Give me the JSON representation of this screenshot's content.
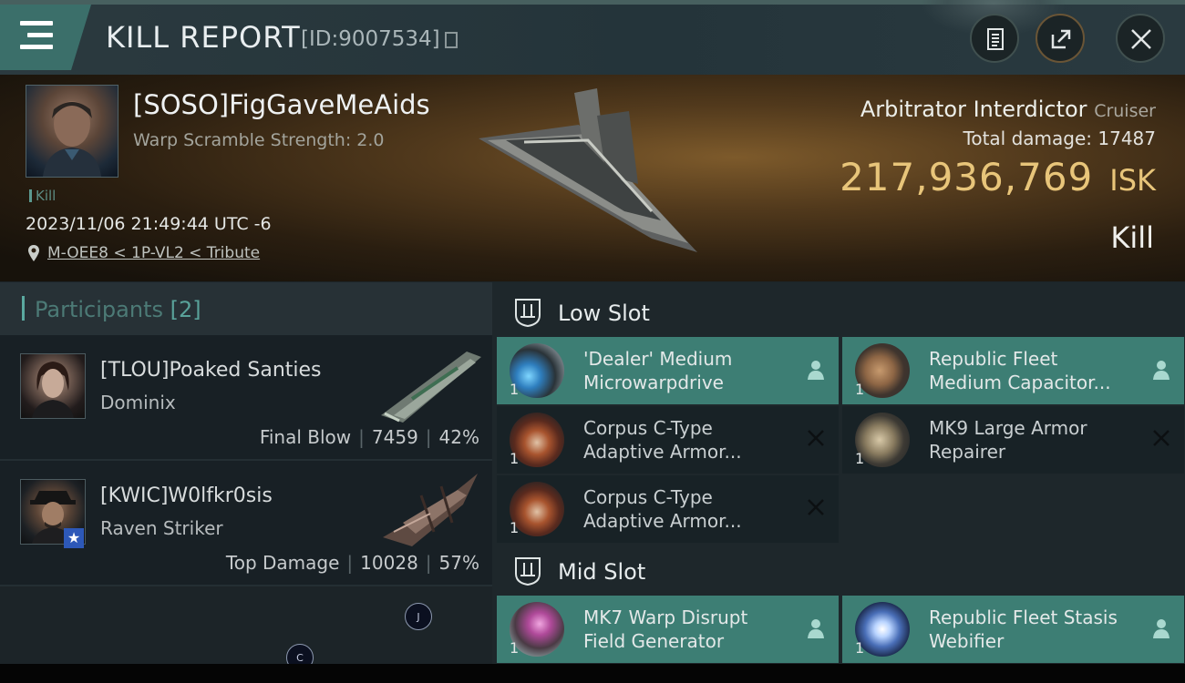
{
  "header": {
    "title": "KILL REPORT",
    "report_id": "[ID:9007534]"
  },
  "summary": {
    "pilot_name": "[SOSO]FigGaveMeAids",
    "warp_scramble": "Warp Scramble Strength: 2.0",
    "kill_tag": "Kill",
    "datetime": "2023/11/06 21:49:44 UTC -6",
    "location": "M-OEE8 < 1P-VL2 < Tribute",
    "ship_name": "Arbitrator Interdictor",
    "ship_class": "Cruiser",
    "total_damage_label": "Total damage:",
    "total_damage": "17487",
    "isk_value": "217,936,769",
    "isk_unit": "ISK",
    "result": "Kill"
  },
  "participants": {
    "title": "Participants",
    "count": "[2]",
    "list": [
      {
        "name": "[TLOU]Poaked Santies",
        "ship": "Dominix",
        "role": "Final Blow",
        "damage": "7459",
        "percent": "42%"
      },
      {
        "name": "[KWIC]W0lfkr0sis",
        "ship": "Raven Striker",
        "role": "Top Damage",
        "damage": "10028",
        "percent": "57%"
      }
    ]
  },
  "float_badges": {
    "j": "J",
    "c": "C"
  },
  "slots": {
    "low": {
      "title": "Low Slot",
      "items": [
        {
          "line1": "'Dealer' Medium",
          "line2": "Microwarpdrive",
          "qty": "1",
          "status": "dropped"
        },
        {
          "line1": "Republic Fleet",
          "line2": "Medium Capacitor...",
          "qty": "1",
          "status": "dropped"
        },
        {
          "line1": "Corpus C-Type",
          "line2": "Adaptive Armor...",
          "qty": "1",
          "status": "destroyed"
        },
        {
          "line1": "MK9 Large Armor",
          "line2": "Repairer",
          "qty": "1",
          "status": "destroyed"
        },
        {
          "line1": "Corpus C-Type",
          "line2": "Adaptive Armor...",
          "qty": "1",
          "status": "destroyed"
        }
      ]
    },
    "mid": {
      "title": "Mid Slot",
      "items": [
        {
          "line1": "MK7 Warp Disrupt",
          "line2": "Field Generator",
          "qty": "1",
          "status": "dropped"
        },
        {
          "line1": "Republic Fleet Stasis",
          "line2": "Webifier",
          "qty": "1",
          "status": "dropped"
        }
      ]
    }
  },
  "colors": {
    "dropped_bg": "#3d7e74",
    "destroyed_bg": "#182226",
    "isk_gold": "#e8c57a",
    "accent_teal": "#5aa9a0"
  }
}
